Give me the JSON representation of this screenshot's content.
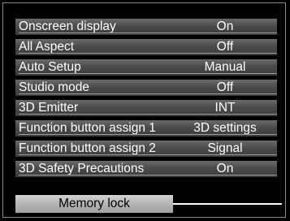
{
  "menu": {
    "items": [
      {
        "label": "Onscreen display",
        "value": "On"
      },
      {
        "label": "All Aspect",
        "value": "Off"
      },
      {
        "label": "Auto Setup",
        "value": "Manual"
      },
      {
        "label": "Studio mode",
        "value": "Off"
      },
      {
        "label": "3D Emitter",
        "value": "INT"
      },
      {
        "label": "Function button assign 1",
        "value": "3D settings"
      },
      {
        "label": "Function button assign 2",
        "value": "Signal"
      },
      {
        "label": "3D Safety Precautions",
        "value": "On"
      }
    ],
    "selected": {
      "label": "Memory lock"
    }
  },
  "colors": {
    "background": "#000000",
    "row_bg": "#4b4b4b",
    "selected_bg": "#b5b5b5",
    "text": "#ffffff"
  }
}
